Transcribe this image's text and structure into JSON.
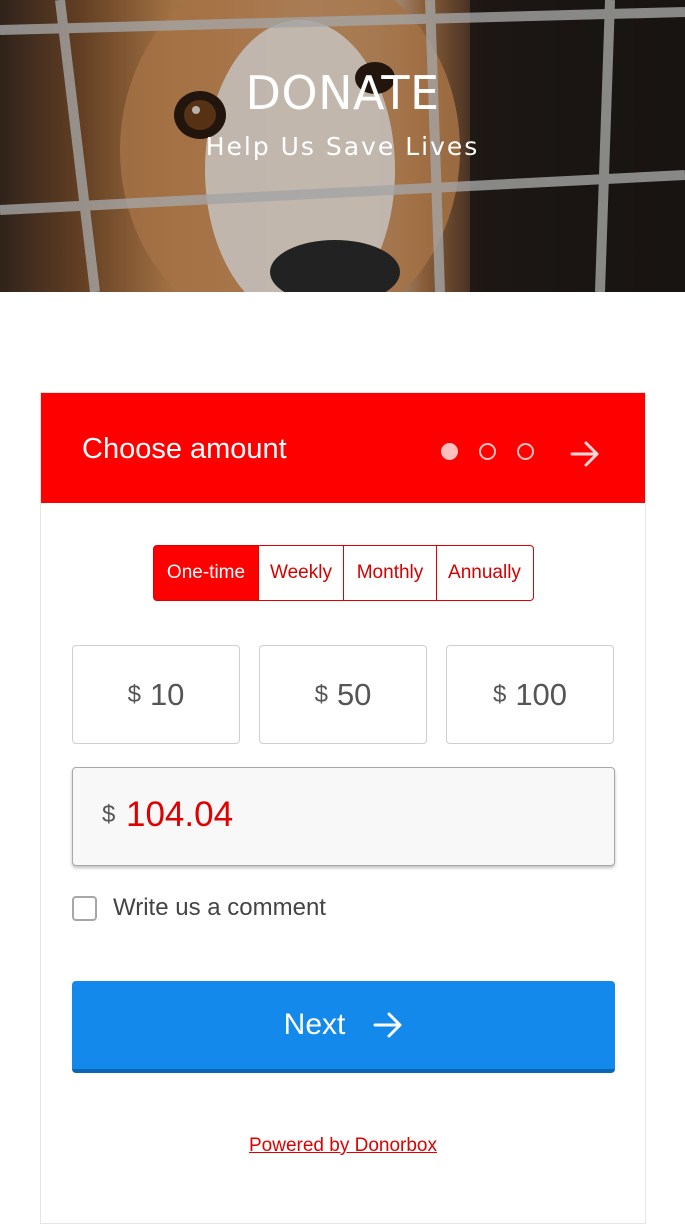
{
  "hero": {
    "title": "DONATE",
    "subtitle": "Help Us Save Lives"
  },
  "form": {
    "title": "Choose amount",
    "steps": {
      "count": 3,
      "current": 1
    },
    "frequency": {
      "options": [
        "One-time",
        "Weekly",
        "Monthly",
        "Annually"
      ],
      "selected": "One-time"
    },
    "currency_symbol": "$",
    "preset_amounts": [
      "10",
      "50",
      "100"
    ],
    "custom_amount": "104.04",
    "comment_label": "Write us a comment",
    "comment_checked": false,
    "next_label": "Next",
    "powered_by": "Powered by Donorbox"
  },
  "colors": {
    "brand_red": "#ff0000",
    "next_blue": "#1389eb"
  }
}
